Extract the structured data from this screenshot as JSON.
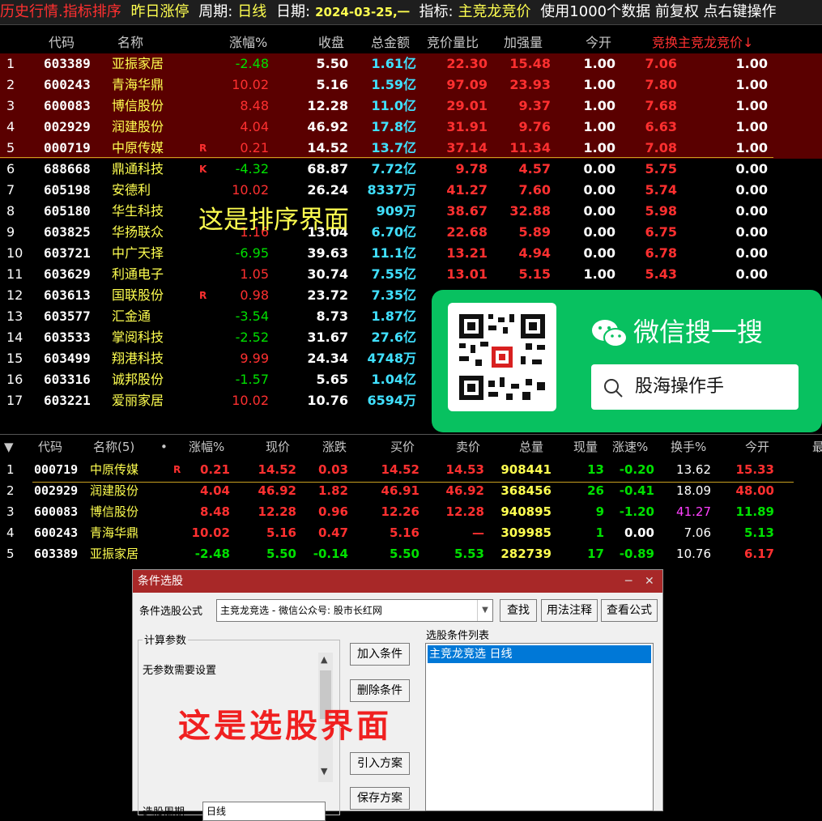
{
  "top": {
    "title": {
      "history": "历史行情.指标排序",
      "subject": "昨日涨停",
      "period_label": "周期:",
      "period": "日线",
      "date_label": "日期:",
      "date": "2024-03-25,一",
      "indicator_label": "指标:",
      "indicator": "主竞龙竞价",
      "tail": "使用1000个数据 前复权 点右键操作"
    },
    "headers": [
      "代码",
      "名称",
      "涨幅%",
      "收盘",
      "总金额",
      "竞价量比",
      "加强量",
      "今开",
      "竞换主竞龙竞价↓"
    ],
    "rows": [
      {
        "n": "1",
        "code": "603389",
        "name": "亚振家居",
        "flag": "",
        "chg": "-2.48",
        "close": "5.50",
        "amt": "1.61亿",
        "ratio": "22.30",
        "boost": "15.48",
        "open": "1.00",
        "swap": "7.06",
        "ind": "1.00"
      },
      {
        "n": "2",
        "code": "600243",
        "name": "青海华鼎",
        "flag": "",
        "chg": "10.02",
        "close": "5.16",
        "amt": "1.59亿",
        "ratio": "97.09",
        "boost": "23.93",
        "open": "1.00",
        "swap": "7.80",
        "ind": "1.00"
      },
      {
        "n": "3",
        "code": "600083",
        "name": "博信股份",
        "flag": "",
        "chg": "8.48",
        "close": "12.28",
        "amt": "11.0亿",
        "ratio": "29.01",
        "boost": "9.37",
        "open": "1.00",
        "swap": "7.68",
        "ind": "1.00"
      },
      {
        "n": "4",
        "code": "002929",
        "name": "润建股份",
        "flag": "",
        "chg": "4.04",
        "close": "46.92",
        "amt": "17.8亿",
        "ratio": "31.91",
        "boost": "9.76",
        "open": "1.00",
        "swap": "6.63",
        "ind": "1.00"
      },
      {
        "n": "5",
        "code": "000719",
        "name": "中原传媒",
        "flag": "R",
        "chg": "0.21",
        "close": "14.52",
        "amt": "13.7亿",
        "ratio": "37.14",
        "boost": "11.34",
        "open": "1.00",
        "swap": "7.08",
        "ind": "1.00"
      },
      {
        "n": "6",
        "code": "688668",
        "name": "鼎通科技",
        "flag": "K",
        "chg": "-4.32",
        "close": "68.87",
        "amt": "7.72亿",
        "ratio": "9.78",
        "boost": "4.57",
        "open": "0.00",
        "swap": "5.75",
        "ind": "0.00"
      },
      {
        "n": "7",
        "code": "605198",
        "name": "安德利",
        "flag": "",
        "chg": "10.02",
        "close": "26.24",
        "amt": "8337万",
        "ratio": "41.27",
        "boost": "7.60",
        "open": "0.00",
        "swap": "5.74",
        "ind": "0.00"
      },
      {
        "n": "8",
        "code": "605180",
        "name": "华生科技",
        "flag": "",
        "chg": "",
        "close": "",
        "amt": "909万",
        "ratio": "38.67",
        "boost": "32.88",
        "open": "0.00",
        "swap": "5.98",
        "ind": "0.00"
      },
      {
        "n": "9",
        "code": "603825",
        "name": "华扬联众",
        "flag": "",
        "chg": "1.16",
        "close": "13.04",
        "amt": "6.70亿",
        "ratio": "22.68",
        "boost": "5.89",
        "open": "0.00",
        "swap": "6.75",
        "ind": "0.00"
      },
      {
        "n": "10",
        "code": "603721",
        "name": "中广天择",
        "flag": "",
        "chg": "-6.95",
        "close": "39.63",
        "amt": "11.1亿",
        "ratio": "13.21",
        "boost": "4.94",
        "open": "0.00",
        "swap": "6.78",
        "ind": "0.00"
      },
      {
        "n": "11",
        "code": "603629",
        "name": "利通电子",
        "flag": "",
        "chg": "1.05",
        "close": "30.74",
        "amt": "7.55亿",
        "ratio": "13.01",
        "boost": "5.15",
        "open": "1.00",
        "swap": "5.43",
        "ind": "0.00"
      },
      {
        "n": "12",
        "code": "603613",
        "name": "国联股份",
        "flag": "R",
        "chg": "0.98",
        "close": "23.72",
        "amt": "7.35亿",
        "ratio": "",
        "boost": "",
        "open": "",
        "swap": "",
        "ind": ""
      },
      {
        "n": "13",
        "code": "603577",
        "name": "汇金通",
        "flag": "",
        "chg": "-3.54",
        "close": "8.73",
        "amt": "1.87亿",
        "ratio": "",
        "boost": "",
        "open": "",
        "swap": "",
        "ind": ""
      },
      {
        "n": "14",
        "code": "603533",
        "name": "掌阅科技",
        "flag": "",
        "chg": "-2.52",
        "close": "31.67",
        "amt": "27.6亿",
        "ratio": "",
        "boost": "",
        "open": "",
        "swap": "",
        "ind": ""
      },
      {
        "n": "15",
        "code": "603499",
        "name": "翔港科技",
        "flag": "",
        "chg": "9.99",
        "close": "24.34",
        "amt": "4748万",
        "ratio": "",
        "boost": "",
        "open": "",
        "swap": "",
        "ind": ""
      },
      {
        "n": "16",
        "code": "603316",
        "name": "诚邦股份",
        "flag": "",
        "chg": "-1.57",
        "close": "5.65",
        "amt": "1.04亿",
        "ratio": "",
        "boost": "",
        "open": "",
        "swap": "",
        "ind": ""
      },
      {
        "n": "17",
        "code": "603221",
        "name": "爱丽家居",
        "flag": "",
        "chg": "10.02",
        "close": "10.76",
        "amt": "6594万",
        "ratio": "",
        "boost": "",
        "open": "",
        "swap": "",
        "ind": ""
      }
    ],
    "overlay_text": "这是排序界面"
  },
  "wechat": {
    "search_title": "微信搜一搜",
    "search_value": "股海操作手"
  },
  "bottom": {
    "headers": [
      "代码",
      "名称(5)",
      "•",
      "涨幅%",
      "现价",
      "涨跌",
      "买价",
      "卖价",
      "总量",
      "现量",
      "涨速%",
      "换手%",
      "今开",
      "最"
    ],
    "rows": [
      {
        "n": "1",
        "code": "000719",
        "name": "中原传媒",
        "flag": "R",
        "chg": "0.21",
        "price": "14.52",
        "diff": "0.03",
        "bid": "14.52",
        "ask": "14.53",
        "vol": "908441",
        "cur": "13",
        "spd": "-0.20",
        "turn": "13.62",
        "open": "15.33"
      },
      {
        "n": "2",
        "code": "002929",
        "name": "润建股份",
        "flag": "",
        "chg": "4.04",
        "price": "46.92",
        "diff": "1.82",
        "bid": "46.91",
        "ask": "46.92",
        "vol": "368456",
        "cur": "26",
        "spd": "-0.41",
        "turn": "18.09",
        "open": "48.00"
      },
      {
        "n": "3",
        "code": "600083",
        "name": "博信股份",
        "flag": "",
        "chg": "8.48",
        "price": "12.28",
        "diff": "0.96",
        "bid": "12.26",
        "ask": "12.28",
        "vol": "940895",
        "cur": "9",
        "spd": "-1.20",
        "turn": "41.27",
        "open": "11.89"
      },
      {
        "n": "4",
        "code": "600243",
        "name": "青海华鼎",
        "flag": "",
        "chg": "10.02",
        "price": "5.16",
        "diff": "0.47",
        "bid": "5.16",
        "ask": "—",
        "vol": "309985",
        "cur": "1",
        "spd": "0.00",
        "turn": "7.06",
        "open": "5.13"
      },
      {
        "n": "5",
        "code": "603389",
        "name": "亚振家居",
        "flag": "",
        "chg": "-2.48",
        "price": "5.50",
        "diff": "-0.14",
        "bid": "5.50",
        "ask": "5.53",
        "vol": "282739",
        "cur": "17",
        "spd": "-0.89",
        "turn": "10.76",
        "open": "6.17"
      }
    ]
  },
  "dialog": {
    "title": "条件选股",
    "formula_label": "条件选股公式",
    "formula_value": "主竞龙竞选  - 微信公众号: 股市长红网",
    "find_btn": "查找",
    "usage_btn": "用法注释",
    "view_btn": "查看公式",
    "params_label": "计算参数",
    "no_params": "无参数需要设置",
    "add_btn": "加入条件",
    "del_btn": "删除条件",
    "import_btn": "引入方案",
    "save_btn": "保存方案",
    "list_label": "选股条件列表",
    "list_items": [
      "主竞龙竞选  日线"
    ],
    "period_label": "选股周期",
    "period_value": "日线",
    "overlay_text": "这是选股界面"
  },
  "colors": {
    "red": "#ff3030",
    "green": "#00e000",
    "cyan": "#40e0ff",
    "yellow": "#ffff50",
    "wechat": "#08c160",
    "title_red": "#a82828"
  }
}
